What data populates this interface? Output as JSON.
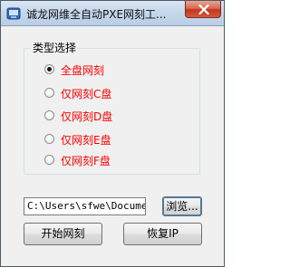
{
  "window": {
    "title": "诚龙网维全自动PXE网刻工..."
  },
  "group": {
    "title": "类型选择",
    "options": [
      {
        "label": "全盘网刻",
        "checked": true
      },
      {
        "label": "仅网刻C盘",
        "checked": false
      },
      {
        "label": "仅网刻D盘",
        "checked": false
      },
      {
        "label": "仅网刻E盘",
        "checked": false
      },
      {
        "label": "仅网刻F盘",
        "checked": false
      }
    ]
  },
  "path": {
    "value": "C:\\Users\\sfwe\\Document"
  },
  "buttons": {
    "browse": "浏览...",
    "start": "开始网刻",
    "restore": "恢复IP"
  },
  "colors": {
    "option_text": "#ff0000"
  },
  "icons": {
    "app": "app-icon",
    "close": "close-icon"
  }
}
